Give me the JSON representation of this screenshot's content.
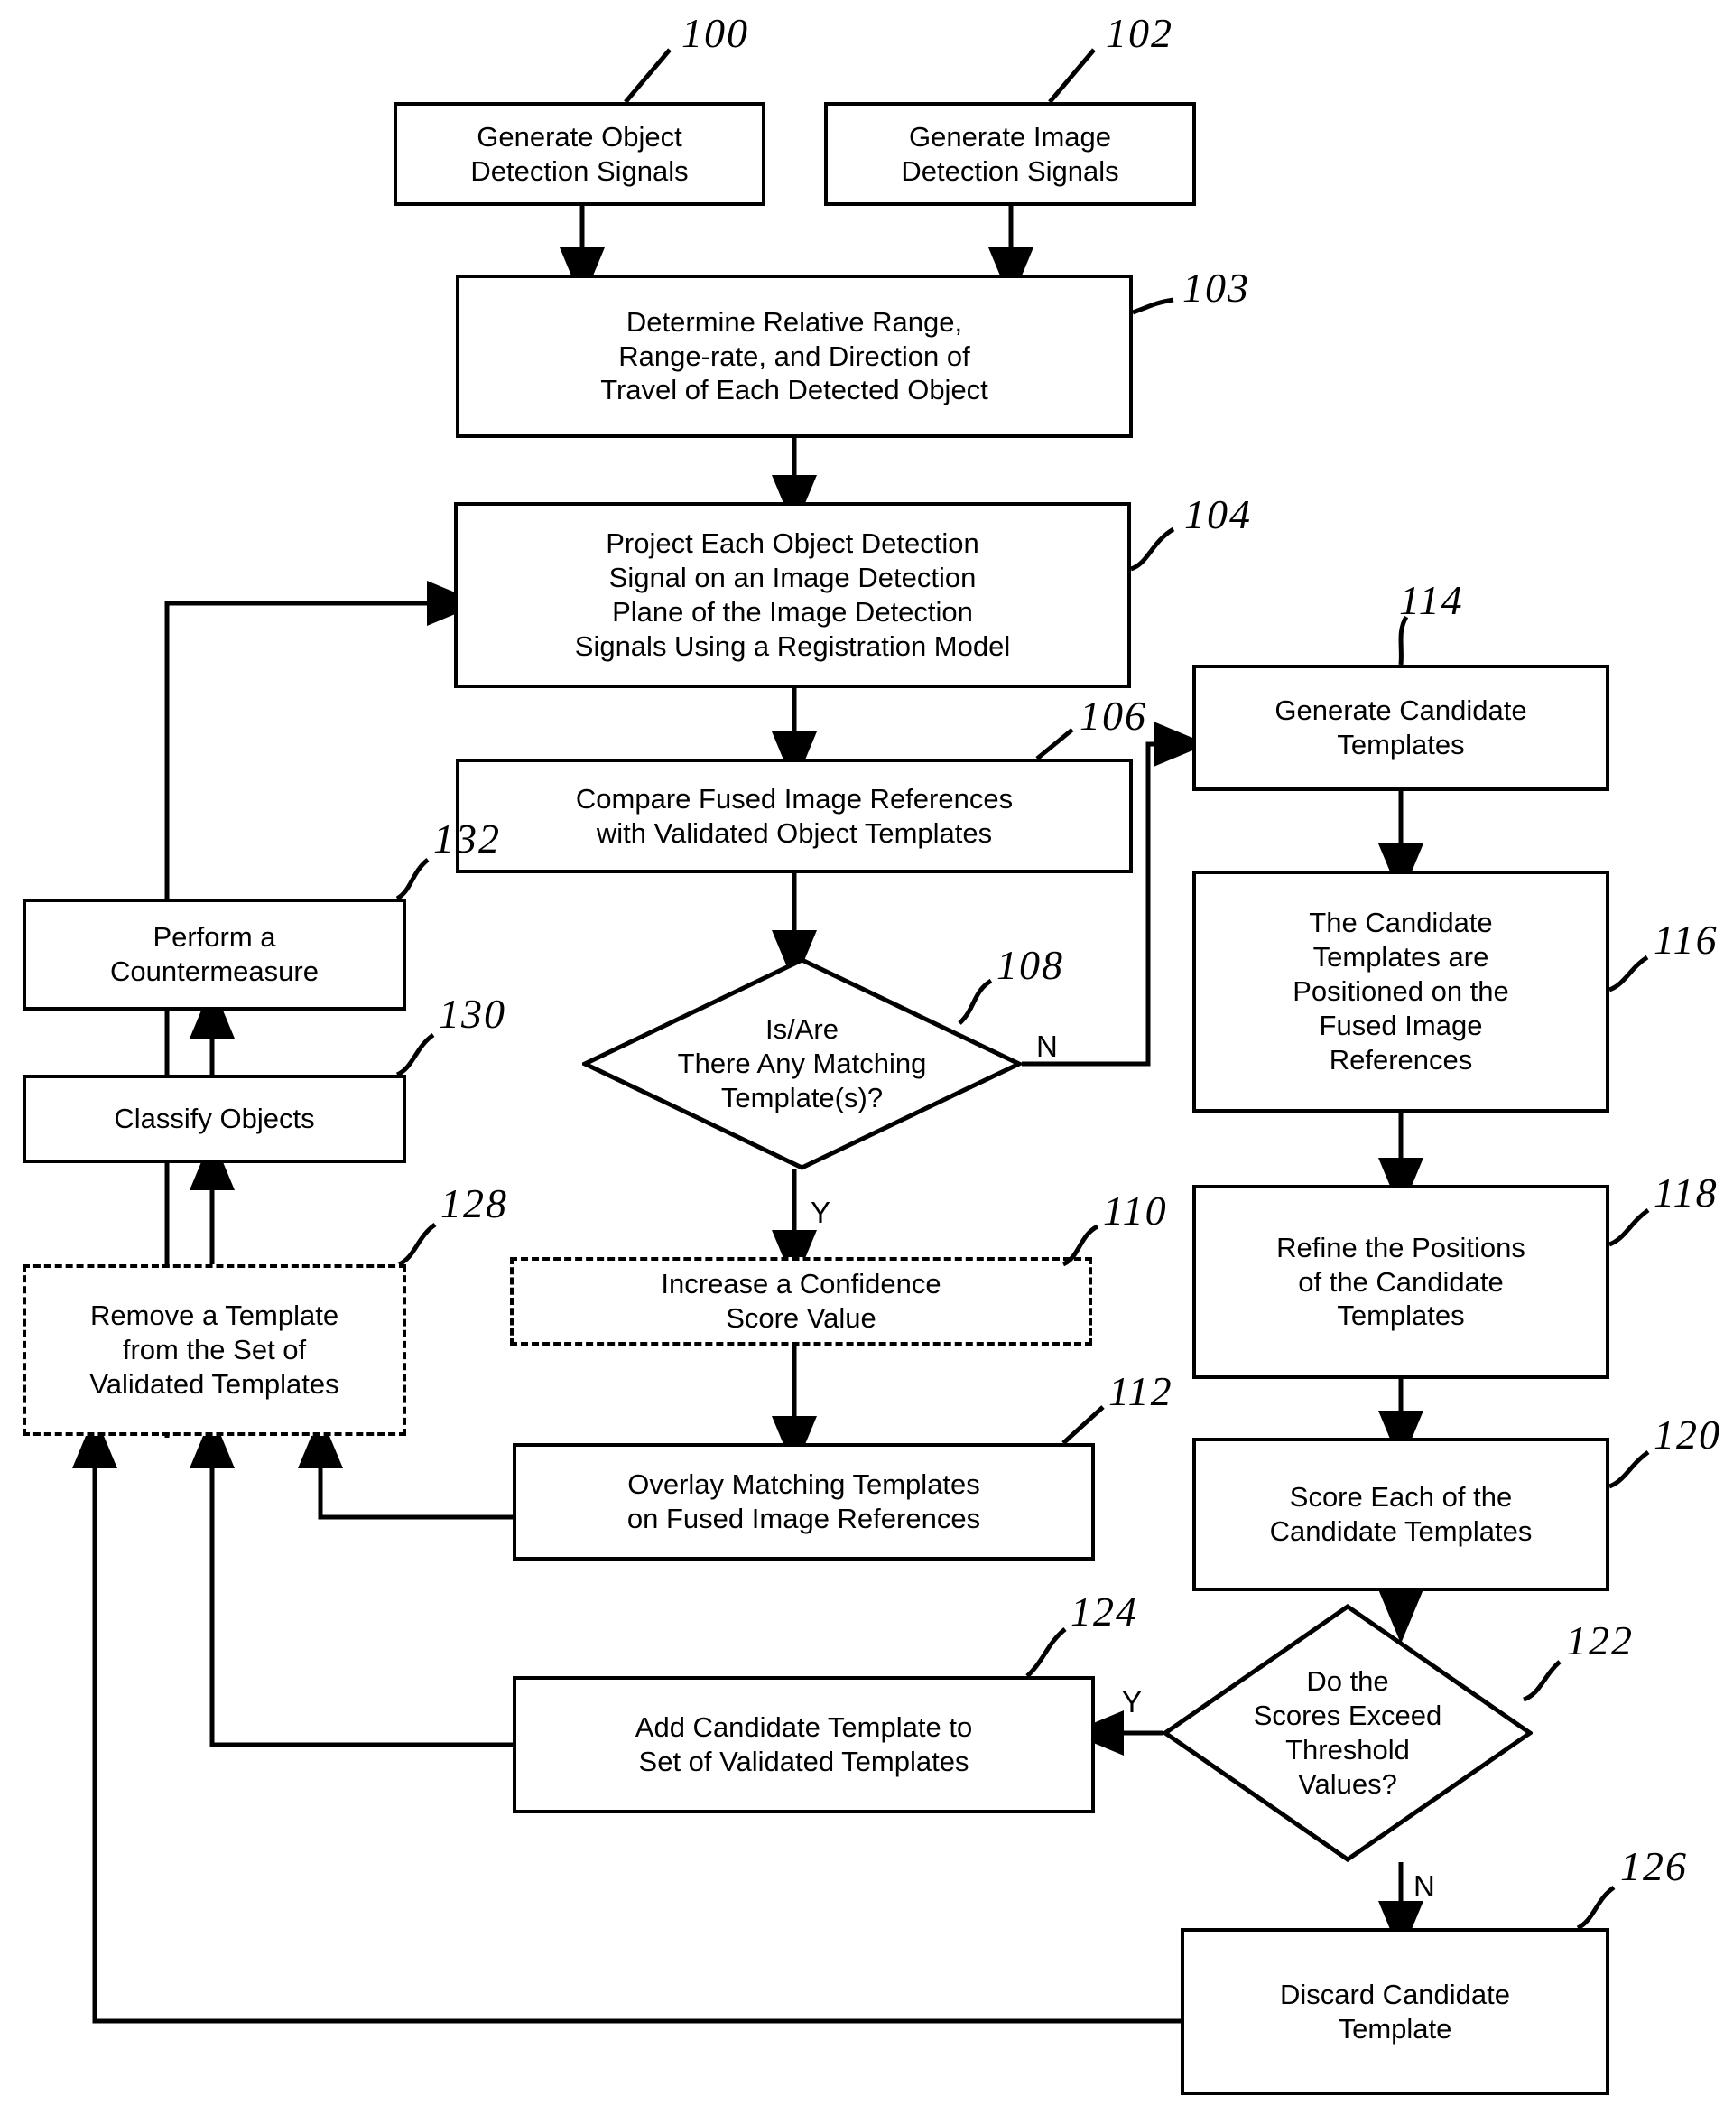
{
  "figure": {
    "type": "patent-flowchart",
    "background": "#ffffff",
    "stroke": "#000000"
  },
  "nodes": [
    {
      "id": "100",
      "shape": "rect",
      "label": "Generate Object\nDetection Signals"
    },
    {
      "id": "102",
      "shape": "rect",
      "label": "Generate Image\nDetection Signals"
    },
    {
      "id": "103",
      "shape": "rect",
      "label": "Determine Relative Range,\nRange-rate, and Direction of\nTravel of Each Detected Object"
    },
    {
      "id": "104",
      "shape": "rect",
      "label": "Project Each  Object Detection\nSignal on an   Image Detection\nPlane of the Image Detection\nSignals Using a Registration Model"
    },
    {
      "id": "106",
      "shape": "rect",
      "label": "Compare Fused Image References\nwith Validated Object Templates"
    },
    {
      "id": "108",
      "shape": "diamond",
      "label": "Is/Are\nThere Any Matching\nTemplate(s)?"
    },
    {
      "id": "110",
      "shape": "rect-dashed",
      "label": "Increase a Confidence\nScore Value"
    },
    {
      "id": "112",
      "shape": "rect",
      "label": "Overlay Matching Templates\non Fused Image References"
    },
    {
      "id": "114",
      "shape": "rect",
      "label": "Generate Candidate\nTemplates"
    },
    {
      "id": "116",
      "shape": "rect",
      "label": "The Candidate\nTemplates are\nPositioned on the\nFused Image\nReferences"
    },
    {
      "id": "118",
      "shape": "rect",
      "label": "Refine the Positions\nof the Candidate\nTemplates"
    },
    {
      "id": "120",
      "shape": "rect",
      "label": "Score Each of the\nCandidate Templates"
    },
    {
      "id": "122",
      "shape": "diamond",
      "label": "Do the\nScores Exceed\nThreshold\nValues?"
    },
    {
      "id": "124",
      "shape": "rect",
      "label": "Add Candidate Template to\nSet of Validated Templates"
    },
    {
      "id": "126",
      "shape": "rect",
      "label": "Discard Candidate\nTemplate"
    },
    {
      "id": "128",
      "shape": "rect-dashed",
      "label": "Remove a Template\nfrom the Set of\nValidated Templates"
    },
    {
      "id": "130",
      "shape": "rect",
      "label": "Classify Objects"
    },
    {
      "id": "132",
      "shape": "rect",
      "label": "Perform a\nCountermeasure"
    }
  ],
  "reference_numerals": [
    {
      "id": "ref-100",
      "text": "100"
    },
    {
      "id": "ref-102",
      "text": "102"
    },
    {
      "id": "ref-103",
      "text": "103"
    },
    {
      "id": "ref-104",
      "text": "104"
    },
    {
      "id": "ref-106",
      "text": "106"
    },
    {
      "id": "ref-108",
      "text": "108"
    },
    {
      "id": "ref-110",
      "text": "110"
    },
    {
      "id": "ref-112",
      "text": "112"
    },
    {
      "id": "ref-114",
      "text": "114"
    },
    {
      "id": "ref-116",
      "text": "116"
    },
    {
      "id": "ref-118",
      "text": "118"
    },
    {
      "id": "ref-120",
      "text": "120"
    },
    {
      "id": "ref-122",
      "text": "122"
    },
    {
      "id": "ref-124",
      "text": "124"
    },
    {
      "id": "ref-126",
      "text": "126"
    },
    {
      "id": "ref-128",
      "text": "128"
    },
    {
      "id": "ref-130",
      "text": "130"
    },
    {
      "id": "ref-132",
      "text": "132"
    }
  ],
  "branch_labels": [
    {
      "id": "branch-108-no",
      "text": "N"
    },
    {
      "id": "branch-108-yes",
      "text": "Y"
    },
    {
      "id": "branch-122-yes",
      "text": "Y"
    },
    {
      "id": "branch-122-no",
      "text": "N"
    }
  ]
}
